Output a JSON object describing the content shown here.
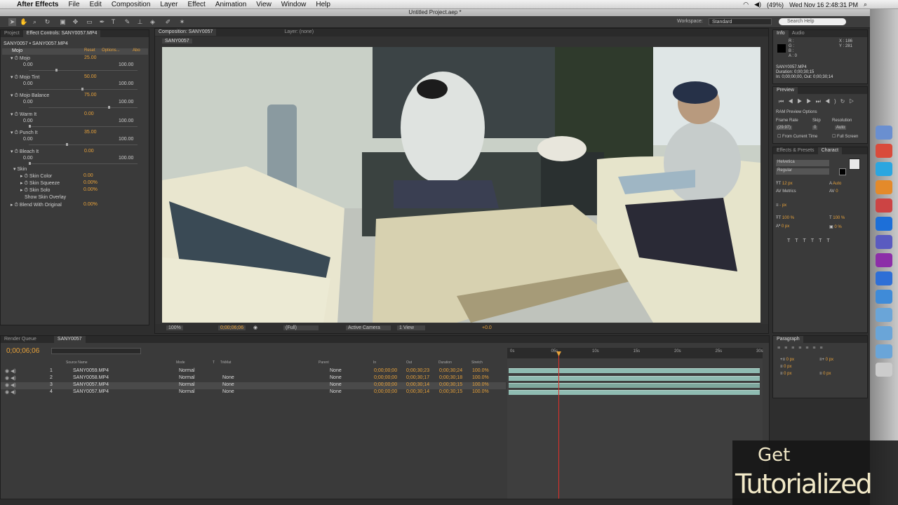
{
  "menubar": {
    "app": "After Effects",
    "items": [
      "File",
      "Edit",
      "Composition",
      "Layer",
      "Effect",
      "Animation",
      "View",
      "Window",
      "Help"
    ],
    "battery": "(49%)",
    "clock": "Wed Nov 16  2:48:31 PM"
  },
  "window": {
    "title": "Untitled Project.aep *"
  },
  "toolbar": {
    "workspace_label": "Workspace:",
    "workspace_value": "Standard",
    "search_placeholder": "Search Help"
  },
  "project_panel": {
    "tabs": [
      "Project",
      "Effect Controls: SANY0057.MP4"
    ],
    "header": "SANY0057 • SANY0057.MP4",
    "effect": {
      "name": "Mojo",
      "reset": "Reset",
      "options": "Options...",
      "about": "Abo"
    },
    "params": [
      {
        "name": "Mojo",
        "value": "25.00",
        "min": "0.00",
        "max": "100.00",
        "knob": 0.25
      },
      {
        "name": "Mojo Tint",
        "value": "50.00",
        "min": "0.00",
        "max": "100.00",
        "knob": 0.5
      },
      {
        "name": "Mojo Balance",
        "value": "75.00",
        "min": "0.00",
        "max": "100.00",
        "knob": 0.75
      },
      {
        "name": "Warm It",
        "value": "0.00",
        "min": "0.00",
        "max": "100.00",
        "knob": 0.0
      },
      {
        "name": "Punch It",
        "value": "35.00",
        "min": "0.00",
        "max": "100.00",
        "knob": 0.35
      },
      {
        "name": "Bleach It",
        "value": "0.00",
        "min": "0.00",
        "max": "100.00",
        "knob": 0.0
      }
    ],
    "skin": {
      "label": "Skin",
      "items": [
        {
          "name": "Skin Color",
          "value": "0.00"
        },
        {
          "name": "Skin Squeeze",
          "value": "0.00%"
        },
        {
          "name": "Skin Solo",
          "value": "0.00%"
        }
      ],
      "overlay": "Show Skin Overlay",
      "blend": "Blend With Original",
      "blend_value": "0.00%"
    }
  },
  "comp_panel": {
    "tab": "Composition: SANY0057",
    "layer_tab": "Layer: (none)",
    "comp_tab": "SANY0057",
    "zoom": "100%",
    "timecode": "0;00;06;06",
    "resolution": "(Full)",
    "camera": "Active Camera",
    "views": "1 View",
    "offset": "+0.0"
  },
  "info_panel": {
    "tabs": [
      "Info",
      "Audio"
    ],
    "channels": [
      "R :",
      "G :",
      "B :",
      "A : 0"
    ],
    "x": "X : 186",
    "y": "Y : 281",
    "file": "SANY0057.MP4",
    "duration": "Duration: 0;00;30;15",
    "in_out": "In: 0;00;00;00, Out: 0;00;30;14"
  },
  "preview_panel": {
    "tab": "Preview",
    "ram": "RAM Preview Options",
    "frame_rate": "Frame Rate",
    "skip": "Skip",
    "resolution": "Resolution",
    "fr_value": "(29.97)",
    "skip_value": "0",
    "res_value": "Auto",
    "from_current": "From Current Time",
    "full_screen": "Full Screen"
  },
  "character_panel": {
    "tabs": [
      "Effects & Presets",
      "Charact"
    ],
    "font": "Helvetica",
    "style": "Regular",
    "size": "12 px",
    "leading": "Auto",
    "kerning": "Metrics",
    "tracking": "0",
    "stroke": "- px",
    "scale_v": "100 %",
    "scale_h": "100 %",
    "baseline": "0 px",
    "tsume": "0 %"
  },
  "paragraph_panel": {
    "tab": "Paragraph",
    "indent1": "0 px",
    "indent2": "0 px",
    "indent3": "0 px",
    "space1": "0 px",
    "space2": "0 px"
  },
  "timeline": {
    "tabs": [
      "Render Queue",
      "SANY0057"
    ],
    "timecode": "0;00;06;06",
    "headers": [
      "Source Name",
      "Mode",
      "T",
      "TrkMat",
      "Parent",
      "In",
      "Out",
      "Duration",
      "Stretch"
    ],
    "layers": [
      {
        "num": "1",
        "name": "SANY0059.MP4",
        "mode": "Normal",
        "trkmat": "",
        "parent": "None",
        "in": "0;00;00;00",
        "out": "0;00;30;23",
        "dur": "0;00;30;24",
        "stretch": "100.0%"
      },
      {
        "num": "2",
        "name": "SANY0058.MP4",
        "mode": "Normal",
        "trkmat": "None",
        "parent": "None",
        "in": "0;00;00;00",
        "out": "0;00;30;17",
        "dur": "0;00;30;18",
        "stretch": "100.0%"
      },
      {
        "num": "3",
        "name": "SANY0057.MP4",
        "mode": "Normal",
        "trkmat": "None",
        "parent": "None",
        "in": "0;00;00;00",
        "out": "0;00;30;14",
        "dur": "0;00;30;15",
        "stretch": "100.0%"
      },
      {
        "num": "4",
        "name": "SANY0057.MP4",
        "mode": "Normal",
        "trkmat": "None",
        "parent": "None",
        "in": "0;00;00;00",
        "out": "0;00;30;14",
        "dur": "0;00;30;15",
        "stretch": "100.0%"
      }
    ],
    "ruler": [
      "0s",
      "05s",
      "10s",
      "15s",
      "20s",
      "25s",
      "30s"
    ]
  },
  "watermark": {
    "line1": "Get",
    "line2": "Tutorialized"
  },
  "colors": {
    "accent": "#e8a23a",
    "timecode": "#e8a23a",
    "playhead": "#e0302a",
    "layer_bar": "#8fbcb2",
    "panel": "#3a3a3a"
  },
  "dock_icons": [
    "finder-icon",
    "chrome-icon",
    "twitter-icon",
    "photos-icon",
    "ical-icon",
    "photoshop-icon",
    "after-effects-icon",
    "premiere-icon",
    "word-icon",
    "itunes-icon",
    "folder-icon",
    "folder-icon",
    "folder-icon",
    "trash-icon"
  ]
}
